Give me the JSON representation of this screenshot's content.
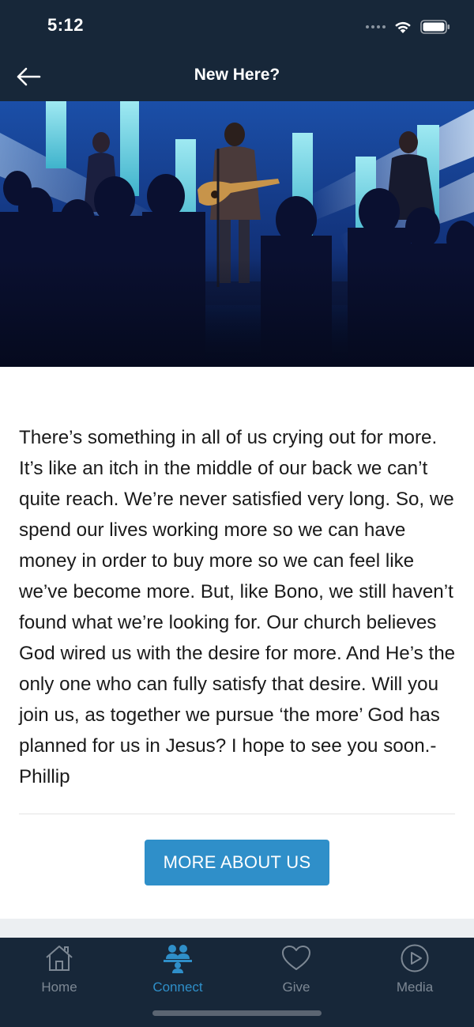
{
  "status_bar": {
    "time": "5:12"
  },
  "nav": {
    "title": "New Here?",
    "back_icon": "arrow-left-icon"
  },
  "hero": {
    "icon": "worship-band-photo"
  },
  "content": {
    "message": "There’s something in all of us crying out for more. It’s like an itch in the middle of our back we can’t quite reach. We’re never satisfied very long. So, we spend our lives working more so we can have money in order to buy more so we can feel like we’ve become more. But, like Bono, we still haven’t found what we’re looking for. Our church believes God wired us with the desire for more. And He’s the only one who can fully satisfy that desire. Will you join us, as together we pursue ‘the more’ God has planned for us in Jesus? I hope to see you soon.- Phillip",
    "button_label": "MORE ABOUT US"
  },
  "tabs": [
    {
      "label": "Home",
      "icon": "home-icon",
      "active": false
    },
    {
      "label": "Connect",
      "icon": "people-icon",
      "active": true
    },
    {
      "label": "Give",
      "icon": "heart-icon",
      "active": false
    },
    {
      "label": "Media",
      "icon": "play-circle-icon",
      "active": false
    }
  ],
  "colors": {
    "bar_background": "#172739",
    "accent": "#2f8fc9",
    "inactive_tab": "#7d8894"
  }
}
